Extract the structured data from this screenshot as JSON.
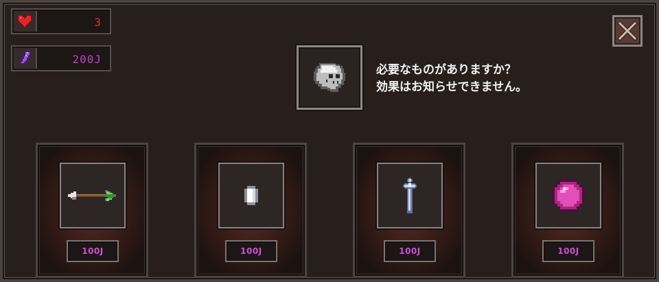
{
  "hud": {
    "health": {
      "icon": "heart-icon",
      "value": "3"
    },
    "currency": {
      "icon": "purple-crystal-icon",
      "value": "200J"
    }
  },
  "close_button": {
    "icon": "close-x-icon"
  },
  "merchant": {
    "portrait_icon": "skull-icon",
    "dialogue": {
      "line1": "必要なものがありますか？",
      "line2": "効果はお知らせできません。"
    }
  },
  "shop_items": [
    {
      "icon": "arrow-icon",
      "price": "100J"
    },
    {
      "icon": "white-crystal-icon",
      "price": "100J"
    },
    {
      "icon": "scepter-icon",
      "price": "100J"
    },
    {
      "icon": "pink-gem-icon",
      "price": "100J"
    }
  ],
  "colors": {
    "health_text": "#d23b33",
    "currency_text": "#c33ed0",
    "price_text": "#cf4fd6",
    "panel_bg": "#281f1d"
  }
}
